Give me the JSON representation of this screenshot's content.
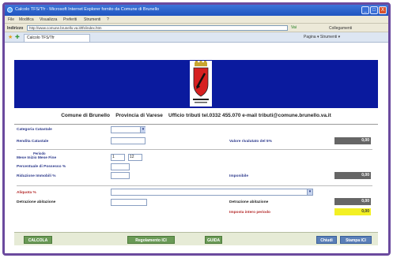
{
  "window": {
    "title": "Calcolo TFS/Tfr - Microsoft Internet Explorer fornito da Comune di Brunello",
    "buttons": [
      "_",
      "□",
      "X"
    ]
  },
  "menu": [
    "File",
    "Modifica",
    "Visualizza",
    "Preferiti",
    "Strumenti",
    "?"
  ],
  "address": {
    "label": "Indirizzo",
    "value": "http://www.comune.brunello.va.it/tfs/index.htm",
    "go": "Vai",
    "links": "Collegamenti"
  },
  "tab": {
    "label": "Calcolo TFS/Tfr",
    "tools": "Pagina ▾   Strumenti ▾"
  },
  "header": {
    "comune": "Comune di Brunello",
    "provincia": "Provincia di Varese",
    "ufficio": "Ufficio tributi  tel.0332 455.070 e-mail tributi@comune.brunello.va.it"
  },
  "form": {
    "categoria_label": "Categoria Catastale",
    "categoria_value": "",
    "rendita_label": "Rendita Catastale",
    "rendita_value": "",
    "valore_label": "Valore rivalutato del 5%",
    "valore_value": "0,00",
    "periodo_title": "Periodo",
    "mese_label": "Mese Inizio   Mese Fine",
    "mese_inizio": "1",
    "mese_fine": "12",
    "percentuale_label": "Percentuale di Possesso %",
    "percentuale_value": "",
    "riduzione_label": "Riduzione Immobili %",
    "riduzione_value": "",
    "imponibile_label": "Imponibile",
    "imponibile_value": "0,00",
    "aliquota_label": "Aliquota %",
    "aliquota_value": "",
    "detrazione_label": "Detrazione abitazione",
    "detrazione_value": "",
    "detrazione_out_label": "Detrazione abitazione",
    "detrazione_out_value": "0,00",
    "imposta_label": "Imposta intero periodo",
    "imposta_value": "0,00"
  },
  "buttons": {
    "calcola": "CALCOLA",
    "regolamento": "Regolamento ICI",
    "guida": "GUIDA",
    "chiudi": "Chiudi",
    "stampa": "Stampa ICI"
  },
  "colors": {
    "banner": "#0a1a9e",
    "label": "#2d3a8c",
    "output_gray": "#666666",
    "output_yellow": "#f3f024",
    "button_green": "#6a9a56",
    "frame": "#6b4a9e"
  }
}
